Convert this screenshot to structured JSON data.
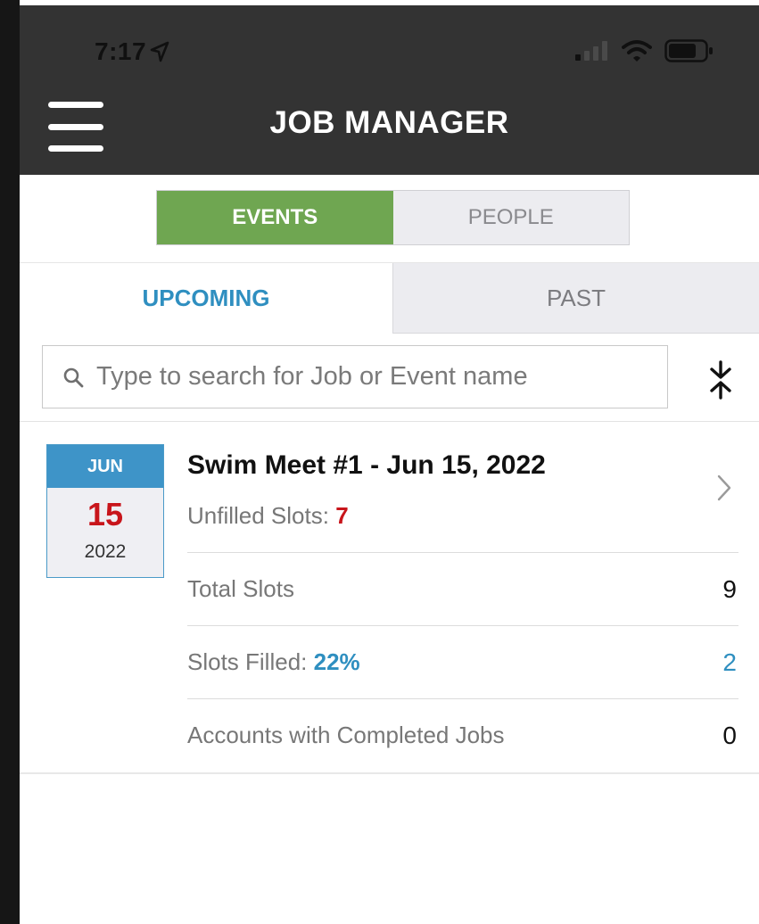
{
  "status_bar": {
    "time": "7:17"
  },
  "header": {
    "title": "JOB MANAGER"
  },
  "segment": {
    "events_label": "EVENTS",
    "people_label": "PEOPLE",
    "selected": "EVENTS"
  },
  "tabs": {
    "upcoming_label": "UPCOMING",
    "past_label": "PAST",
    "selected": "UPCOMING"
  },
  "search": {
    "placeholder": "Type to search for Job or Event name",
    "value": ""
  },
  "event": {
    "date": {
      "month": "JUN",
      "day": "15",
      "year": "2022"
    },
    "title": "Swim Meet #1 - Jun 15, 2022",
    "unfilled_label": "Unfilled Slots: ",
    "unfilled_value": "7",
    "rows": {
      "total_label": "Total Slots",
      "total_value": "9",
      "filled_label": "Slots Filled: ",
      "filled_percent": "22%",
      "filled_value": "2",
      "accounts_label": "Accounts with Completed Jobs",
      "accounts_value": "0"
    }
  },
  "colors": {
    "header_bg": "#333333",
    "events_active": "#6fa651",
    "accent_blue": "#2f8fc0",
    "alert_red": "#c8151b"
  }
}
